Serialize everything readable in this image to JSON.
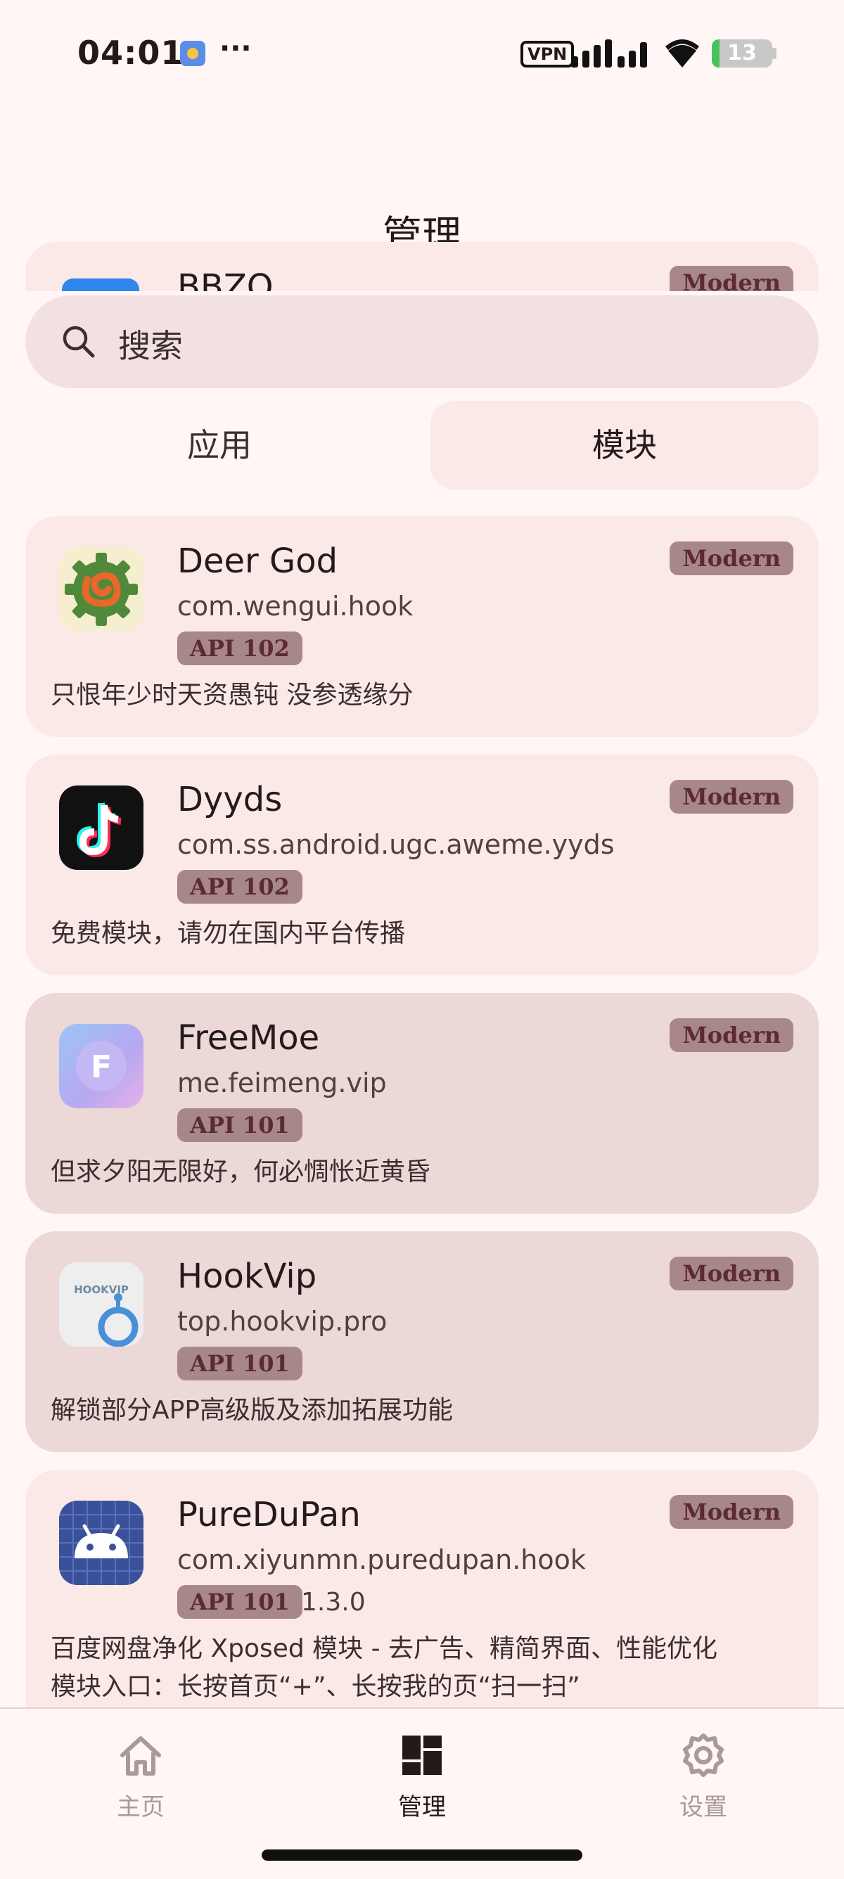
{
  "status_bar": {
    "time": "04:01",
    "dots": "···",
    "vpn": "VPN",
    "battery": "13",
    "battery_level": 0.13
  },
  "header": {
    "title": "管理"
  },
  "ghost_card": {
    "name": "BBZQ",
    "badge": "Modern"
  },
  "search": {
    "placeholder": "搜索"
  },
  "tabs": [
    {
      "label": "应用",
      "selected": false
    },
    {
      "label": "模块",
      "selected": true
    }
  ],
  "modules": [
    {
      "name": "Deer God",
      "package": "com.wengui.hook",
      "api": "API 102",
      "version": "",
      "badge": "Modern",
      "description": [
        "只恨年少时天资愚钝 没参透缘分"
      ],
      "icon": "gear-pretzel-icon"
    },
    {
      "name": "Dyyds",
      "package": "com.ss.android.ugc.aweme.yyds",
      "api": "API 102",
      "version": "",
      "badge": "Modern",
      "description": [
        "免费模块，请勿在国内平台传播"
      ],
      "icon": "tiktok-icon"
    },
    {
      "name": "FreeMoe",
      "package": "me.feimeng.vip",
      "api": "API 101",
      "version": "",
      "badge": "Modern",
      "description": [
        "但求夕阳无限好，何必惆怅近黄昏"
      ],
      "icon": "freemoe-icon"
    },
    {
      "name": "HookVip",
      "package": "top.hookvip.pro",
      "api": "API 101",
      "version": "",
      "badge": "Modern",
      "description": [
        "解锁部分APP高级版及添加拓展功能"
      ],
      "icon": "hookvip-icon",
      "icon_text": "HOOKVIP"
    },
    {
      "name": "PureDuPan",
      "package": "com.xiyunmn.puredupan.hook",
      "api": "API 101",
      "version": "1.3.0",
      "badge": "Modern",
      "description": [
        "百度网盘净化 Xposed 模块 - 去广告、精简界面、性能优化",
        "模块入口：长按首页“+”、长按我的页“扫一扫”"
      ],
      "icon": "android-icon"
    }
  ],
  "bottom_nav": [
    {
      "label": "主页",
      "icon": "home-icon",
      "active": false
    },
    {
      "label": "管理",
      "icon": "dashboard-icon",
      "active": true
    },
    {
      "label": "设置",
      "icon": "gear-icon",
      "active": false
    }
  ]
}
